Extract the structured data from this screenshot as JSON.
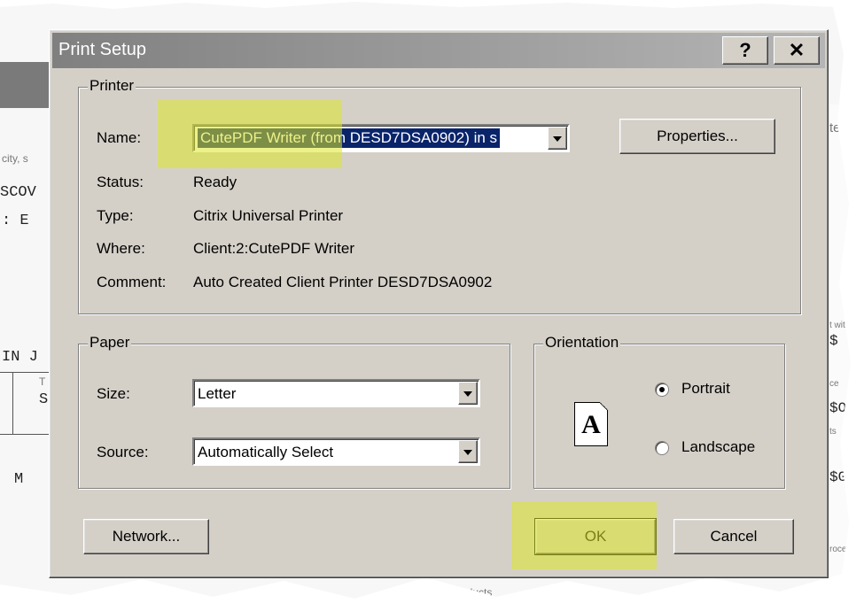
{
  "background": {
    "fragments": [
      "city, s",
      "SCOV",
      ": E",
      "IN J",
      "T",
      "S",
      "M",
      "te",
      "t wit",
      "$",
      "$O",
      "ce",
      "ts",
      "$G",
      "roced",
      "oducts",
      "buye"
    ]
  },
  "dialog": {
    "title": "Print Setup",
    "help_label": "?",
    "close_label": "✕",
    "printer": {
      "group_label": "Printer",
      "name_label": "Name:",
      "name_value": "CutePDF Writer (from DESD7DSA0902) in s",
      "properties_label": "Properties...",
      "status_label": "Status:",
      "status_value": "Ready",
      "type_label": "Type:",
      "type_value": "Citrix Universal Printer",
      "where_label": "Where:",
      "where_value": "Client:2:CutePDF Writer",
      "comment_label": "Comment:",
      "comment_value": "Auto Created Client Printer DESD7DSA0902"
    },
    "paper": {
      "group_label": "Paper",
      "size_label": "Size:",
      "size_value": "Letter",
      "source_label": "Source:",
      "source_value": "Automatically Select"
    },
    "orientation": {
      "group_label": "Orientation",
      "icon_letter": "A",
      "portrait_label": "Portrait",
      "landscape_label": "Landscape",
      "selected": "Portrait"
    },
    "buttons": {
      "network_label": "Network...",
      "ok_label": "OK",
      "cancel_label": "Cancel"
    }
  },
  "colors": {
    "highlight": "#dce628",
    "selection": "#0a246a",
    "dialog_face": "#d4d0c8"
  }
}
